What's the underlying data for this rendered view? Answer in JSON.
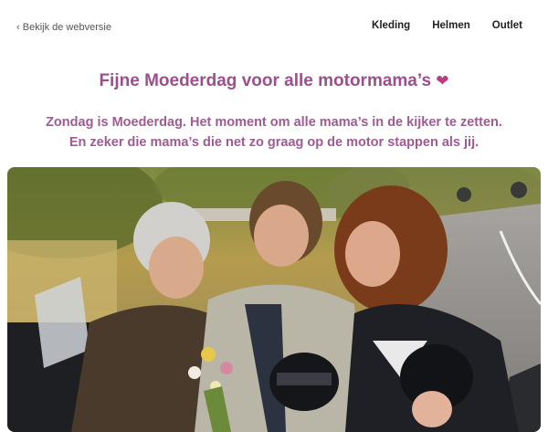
{
  "header": {
    "webversie_icon": "chevron-left",
    "webversie_label": "Bekijk de webversie",
    "nav": [
      {
        "label": "Kleding"
      },
      {
        "label": "Helmen"
      },
      {
        "label": "Outlet"
      }
    ]
  },
  "content": {
    "title": "Fijne Moederdag voor alle motormama’s",
    "title_icon": "heart",
    "intro_line1": "Zondag is Moederdag. Het moment om alle mama’s in de kijker te zetten.",
    "intro_line2": "En zeker die mama’s die net zo graag op de motor stappen als jij."
  },
  "colors": {
    "title": "#9b4f8f",
    "intro": "#a05b94",
    "heart": "#b83e7f"
  }
}
